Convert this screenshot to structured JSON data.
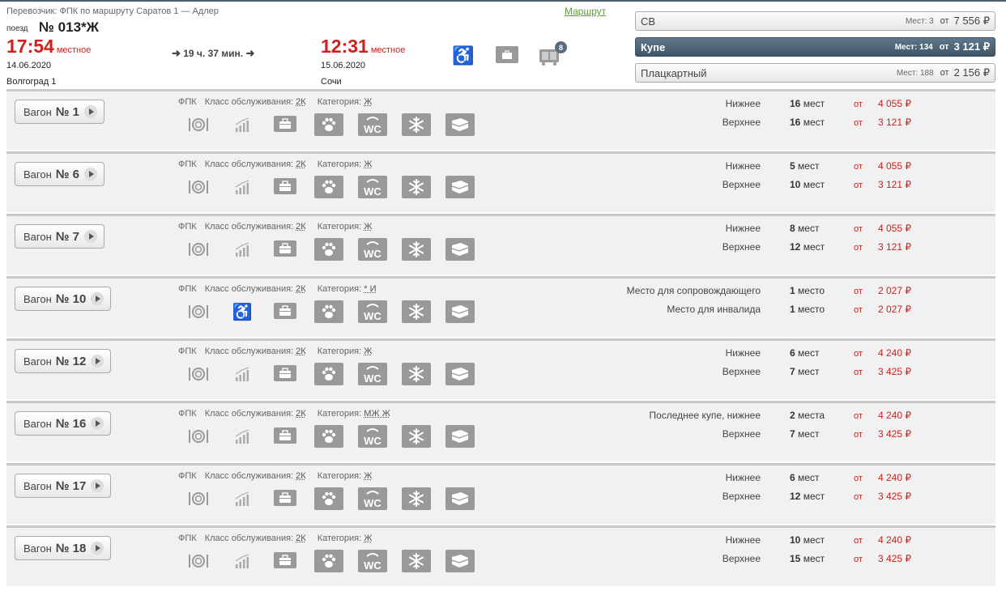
{
  "header": {
    "carrier_line": "Перевозчик: ФПК   по маршруту Саратов 1 — Адлер",
    "route_link": "Маршрут",
    "train_label": "поезд",
    "train_number": "№ 013*Ж",
    "departure": {
      "time": "17:54",
      "time_note": "местное",
      "date": "14.06.2020",
      "station": "Волгоград 1"
    },
    "duration": "19 ч. 37 мин.",
    "arrival": {
      "time": "12:31",
      "time_note": "местное",
      "date": "15.06.2020",
      "station": "Сочи"
    },
    "luggage_badge": "8",
    "icons": [
      "wheelchair-icon",
      "bag-icon",
      "luggage-icon"
    ]
  },
  "classes": [
    {
      "name": "СВ",
      "seats": "Мест: 3",
      "from": "от",
      "price": "7 556 ₽",
      "active": false
    },
    {
      "name": "Купе",
      "seats": "Мест: 134",
      "from": "от",
      "price": "3 121 ₽",
      "active": true
    },
    {
      "name": "Плацкартный",
      "seats": "Мест: 188",
      "from": "от",
      "price": "2 156 ₽",
      "active": false
    }
  ],
  "wagons": [
    {
      "label": "Вагон",
      "number": "№ 1",
      "carrier": "ФПК",
      "service_label": "Класс обслуживания:",
      "service": "2К",
      "category_label": "Категория:",
      "category": "Ж",
      "second_icon": "chart",
      "rows": [
        {
          "label": "Нижнее",
          "seats_num": "16",
          "seats_word": "мест",
          "from": "от",
          "price": "4 055 ₽"
        },
        {
          "label": "Верхнее",
          "seats_num": "16",
          "seats_word": "мест",
          "from": "от",
          "price": "3 121 ₽"
        }
      ]
    },
    {
      "label": "Вагон",
      "number": "№ 6",
      "carrier": "ФПК",
      "service_label": "Класс обслуживания:",
      "service": "2К",
      "category_label": "Категория:",
      "category": "Ж",
      "second_icon": "chart",
      "rows": [
        {
          "label": "Нижнее",
          "seats_num": "5",
          "seats_word": "мест",
          "from": "от",
          "price": "4 055 ₽"
        },
        {
          "label": "Верхнее",
          "seats_num": "10",
          "seats_word": "мест",
          "from": "от",
          "price": "3 121 ₽"
        }
      ]
    },
    {
      "label": "Вагон",
      "number": "№ 7",
      "carrier": "ФПК",
      "service_label": "Класс обслуживания:",
      "service": "2К",
      "category_label": "Категория:",
      "category": "Ж",
      "second_icon": "chart",
      "rows": [
        {
          "label": "Нижнее",
          "seats_num": "8",
          "seats_word": "мест",
          "from": "от",
          "price": "4 055 ₽"
        },
        {
          "label": "Верхнее",
          "seats_num": "12",
          "seats_word": "мест",
          "from": "от",
          "price": "3 121 ₽"
        }
      ]
    },
    {
      "label": "Вагон",
      "number": "№ 10",
      "carrier": "ФПК",
      "service_label": "Класс обслуживания:",
      "service": "2К",
      "category_label": "Категория:",
      "category": "* И",
      "second_icon": "wheelchair",
      "rows": [
        {
          "label": "Место для сопровождающего",
          "seats_num": "1",
          "seats_word": "место",
          "from": "от",
          "price": "2 027 ₽"
        },
        {
          "label": "Место для инвалида",
          "seats_num": "1",
          "seats_word": "место",
          "from": "от",
          "price": "2 027 ₽"
        }
      ]
    },
    {
      "label": "Вагон",
      "number": "№ 12",
      "carrier": "ФПК",
      "service_label": "Класс обслуживания:",
      "service": "2К",
      "category_label": "Категория:",
      "category": "Ж",
      "second_icon": "chart",
      "rows": [
        {
          "label": "Нижнее",
          "seats_num": "6",
          "seats_word": "мест",
          "from": "от",
          "price": "4 240 ₽"
        },
        {
          "label": "Верхнее",
          "seats_num": "7",
          "seats_word": "мест",
          "from": "от",
          "price": "3 425 ₽"
        }
      ]
    },
    {
      "label": "Вагон",
      "number": "№ 16",
      "carrier": "ФПК",
      "service_label": "Класс обслуживания:",
      "service": "2К",
      "category_label": "Категория:",
      "category": "МЖ Ж",
      "second_icon": "chart",
      "rows": [
        {
          "label": "Последнее купе, нижнее",
          "seats_num": "2",
          "seats_word": "места",
          "from": "от",
          "price": "4 240 ₽"
        },
        {
          "label": "Верхнее",
          "seats_num": "7",
          "seats_word": "мест",
          "from": "от",
          "price": "3 425 ₽"
        }
      ]
    },
    {
      "label": "Вагон",
      "number": "№ 17",
      "carrier": "ФПК",
      "service_label": "Класс обслуживания:",
      "service": "2К",
      "category_label": "Категория:",
      "category": "Ж",
      "second_icon": "chart",
      "rows": [
        {
          "label": "Нижнее",
          "seats_num": "6",
          "seats_word": "мест",
          "from": "от",
          "price": "4 240 ₽"
        },
        {
          "label": "Верхнее",
          "seats_num": "12",
          "seats_word": "мест",
          "from": "от",
          "price": "3 425 ₽"
        }
      ]
    },
    {
      "label": "Вагон",
      "number": "№ 18",
      "carrier": "ФПК",
      "service_label": "Класс обслуживания:",
      "service": "2К",
      "category_label": "Категория:",
      "category": "Ж",
      "second_icon": "chart",
      "rows": [
        {
          "label": "Нижнее",
          "seats_num": "10",
          "seats_word": "мест",
          "from": "от",
          "price": "4 240 ₽"
        },
        {
          "label": "Верхнее",
          "seats_num": "15",
          "seats_word": "мест",
          "from": "от",
          "price": "3 425 ₽"
        }
      ]
    }
  ],
  "amenity_icons": [
    "food-icon",
    "bag-icon",
    "pets-icon",
    "wc-icon",
    "ac-icon",
    "linen-icon"
  ]
}
